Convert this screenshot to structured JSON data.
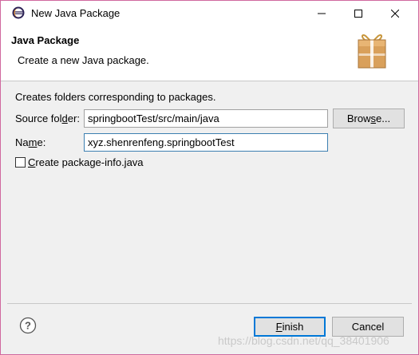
{
  "window": {
    "title": "New Java Package",
    "icon": "eclipse-icon",
    "controls": {
      "minimize": "minimize-icon",
      "maximize": "maximize-icon",
      "close": "close-icon"
    }
  },
  "banner": {
    "title": "Java Package",
    "description": "Create a new Java package.",
    "icon": "package-wizard-icon"
  },
  "form": {
    "intro": "Creates folders corresponding to packages.",
    "source_folder": {
      "label_pre": "Source fol",
      "label_mnemonic": "d",
      "label_post": "er:",
      "value": "springbootTest/src/main/java",
      "browse_pre": "Brow",
      "browse_mnemonic": "s",
      "browse_post": "e..."
    },
    "name": {
      "label_pre": "Na",
      "label_mnemonic": "m",
      "label_post": "e:",
      "value": "xyz.shenrenfeng.springbootTest"
    },
    "package_info": {
      "checked": false,
      "label_mnemonic": "C",
      "label_post": "reate package-info.java"
    }
  },
  "footer": {
    "help_icon": "help-icon",
    "finish_mnemonic": "F",
    "finish_post": "inish",
    "cancel": "Cancel"
  },
  "watermark": "https://blog.csdn.net/qq_38401906",
  "colors": {
    "window_border": "#d0689e",
    "focus_border": "#3c7fb1",
    "default_button": "#0078d7"
  }
}
